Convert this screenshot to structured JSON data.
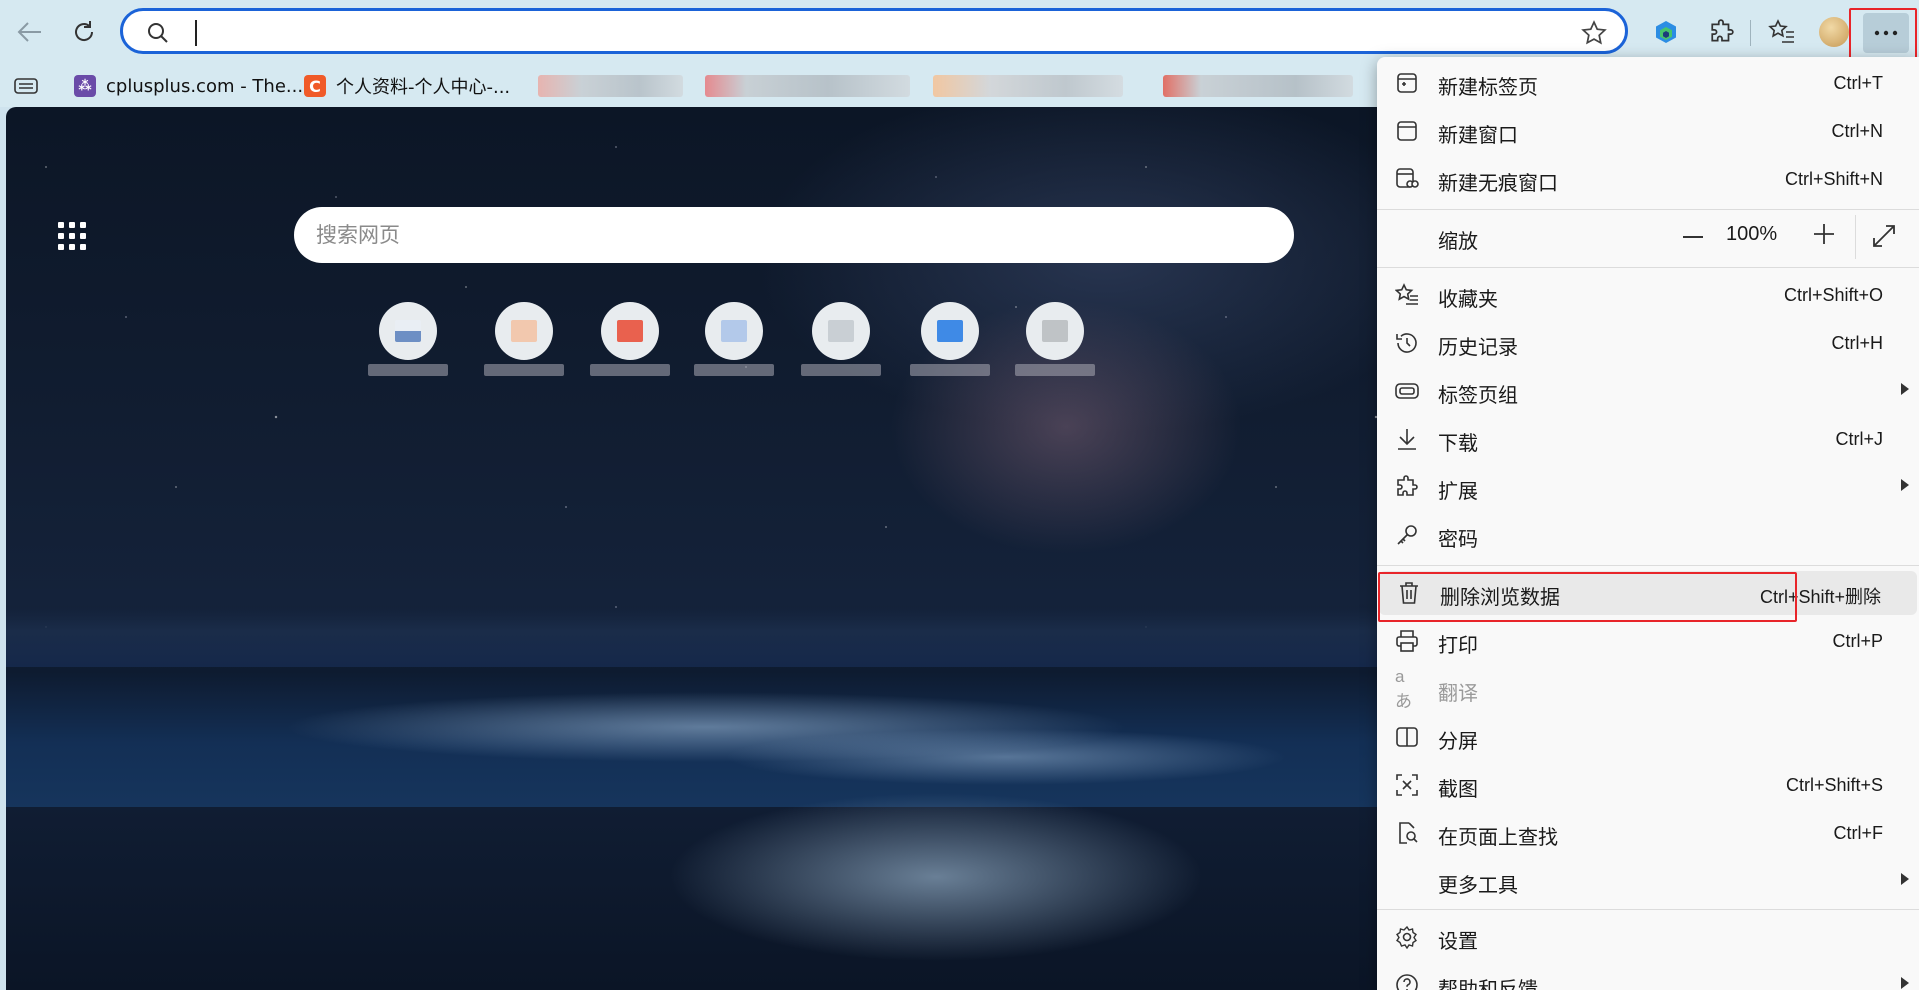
{
  "addressbar": {
    "value": "",
    "placeholder": ""
  },
  "bookmarks": [
    {
      "label": "cplusplus.com - The..."
    },
    {
      "label": "个人资料-个人中心-..."
    }
  ],
  "newtab": {
    "search_placeholder": "搜索网页"
  },
  "menu": {
    "new_tab": {
      "label": "新建标签页",
      "shortcut": "Ctrl+T"
    },
    "new_window": {
      "label": "新建窗口",
      "shortcut": "Ctrl+N"
    },
    "new_inprivate": {
      "label": "新建无痕窗口",
      "shortcut": "Ctrl+Shift+N"
    },
    "zoom": {
      "label": "缩放",
      "value": "100%"
    },
    "favorites": {
      "label": "收藏夹",
      "shortcut": "Ctrl+Shift+O"
    },
    "history": {
      "label": "历史记录",
      "shortcut": "Ctrl+H"
    },
    "tab_groups": {
      "label": "标签页组"
    },
    "downloads": {
      "label": "下载",
      "shortcut": "Ctrl+J"
    },
    "extensions": {
      "label": "扩展"
    },
    "passwords": {
      "label": "密码"
    },
    "clear_data": {
      "label": "删除浏览数据",
      "shortcut": "Ctrl+Shift+删除"
    },
    "print": {
      "label": "打印",
      "shortcut": "Ctrl+P"
    },
    "translate": {
      "label": "翻译"
    },
    "split_screen": {
      "label": "分屏"
    },
    "screenshot": {
      "label": "截图",
      "shortcut": "Ctrl+Shift+S"
    },
    "find": {
      "label": "在页面上查找",
      "shortcut": "Ctrl+F"
    },
    "more_tools": {
      "label": "更多工具"
    },
    "settings": {
      "label": "设置"
    },
    "help": {
      "label": "帮助和反馈"
    }
  },
  "colors": {
    "accent": "#1b63d8",
    "highlight_box": "#e8252a",
    "menu_bg": "#f9f9f9"
  }
}
